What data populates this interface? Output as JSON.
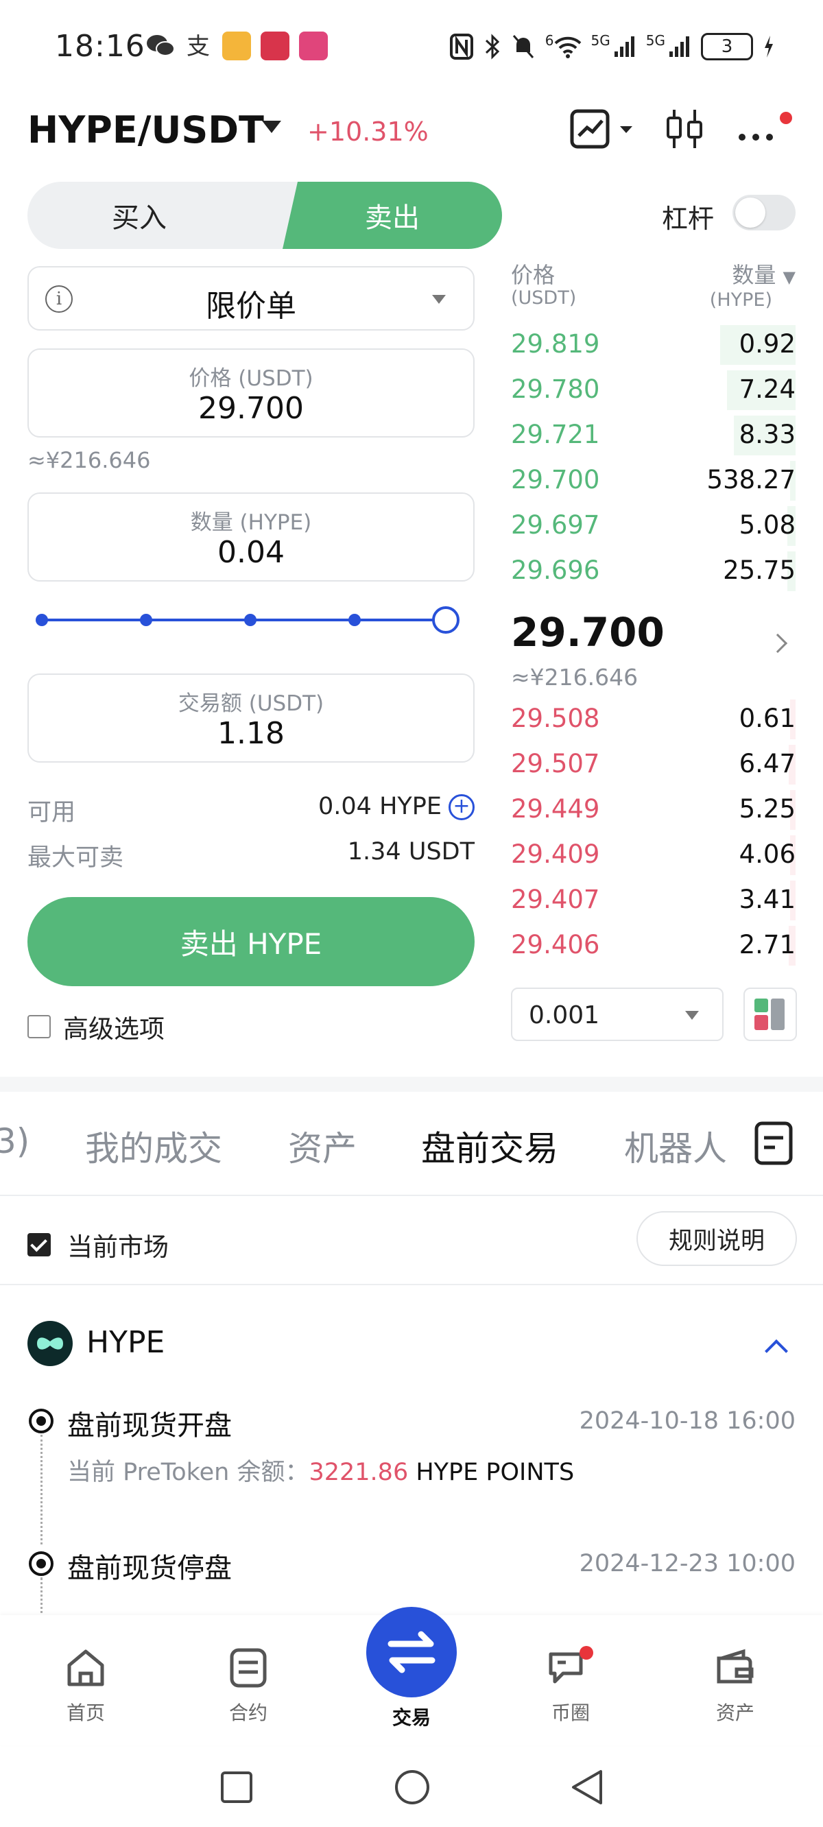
{
  "status_bar": {
    "time": "18:16",
    "battery": "3",
    "signal1": "5G",
    "signal2": "5G",
    "wifi_badge": "6"
  },
  "header": {
    "pair": "HYPE/USDT",
    "change": "+10.31%"
  },
  "trade_tabs": {
    "buy": "买入",
    "sell": "卖出",
    "active": "sell"
  },
  "leverage": {
    "label": "杠杆",
    "enabled": false
  },
  "order_type": {
    "label": "限价单"
  },
  "price_field": {
    "label": "价格 (USDT)",
    "value": "29.700",
    "cny": "≈¥216.646"
  },
  "qty_field": {
    "label": "数量 (HYPE)",
    "value": "0.04"
  },
  "slider": {
    "percent": 100
  },
  "amount_field": {
    "label": "交易额 (USDT)",
    "value": "1.18"
  },
  "available": {
    "label": "可用",
    "value": "0.04 HYPE"
  },
  "max_sell": {
    "label": "最大可卖",
    "value": "1.34 USDT"
  },
  "sell_button": {
    "label": "卖出 HYPE"
  },
  "advanced": {
    "label": "高级选项"
  },
  "orderbook": {
    "price_header": "价格",
    "price_unit": "(USDT)",
    "qty_header": "数量",
    "qty_unit": "(HYPE)",
    "asks": [
      {
        "price": "29.819",
        "qty": "0.92"
      },
      {
        "price": "29.780",
        "qty": "7.24"
      },
      {
        "price": "29.721",
        "qty": "8.33"
      },
      {
        "price": "29.700",
        "qty": "538.27"
      },
      {
        "price": "29.697",
        "qty": "5.08"
      },
      {
        "price": "29.696",
        "qty": "25.75"
      }
    ],
    "last_price": "29.700",
    "last_cny": "≈¥216.646",
    "bids": [
      {
        "price": "29.508",
        "qty": "0.61"
      },
      {
        "price": "29.507",
        "qty": "6.47"
      },
      {
        "price": "29.449",
        "qty": "5.25"
      },
      {
        "price": "29.409",
        "qty": "4.06"
      },
      {
        "price": "29.407",
        "qty": "3.41"
      },
      {
        "price": "29.406",
        "qty": "2.71"
      }
    ],
    "precision": "0.001"
  },
  "bottom_tabs": {
    "partial": "3)",
    "t1": "我的成交",
    "t2": "资产",
    "t3": "盘前交易",
    "t4": "机器人"
  },
  "current_market": {
    "label": "当前市场",
    "checked": true
  },
  "rules_button": "规则说明",
  "token": {
    "name": "HYPE"
  },
  "timeline": [
    {
      "title": "盘前现货开盘",
      "time": "2024-10-18 16:00",
      "sub_prefix": "当前 PreToken 余额：",
      "sub_value": "3221.86",
      "sub_unit": "HYPE POINTS"
    },
    {
      "title": "盘前现货停盘",
      "time": "2024-12-23 10:00"
    }
  ],
  "nav": {
    "home": "首页",
    "futures": "合约",
    "trade": "交易",
    "community": "币圈",
    "assets": "资产"
  },
  "colors": {
    "green": "#55b87a",
    "red": "#e0536a",
    "blue": "#2851d9"
  }
}
